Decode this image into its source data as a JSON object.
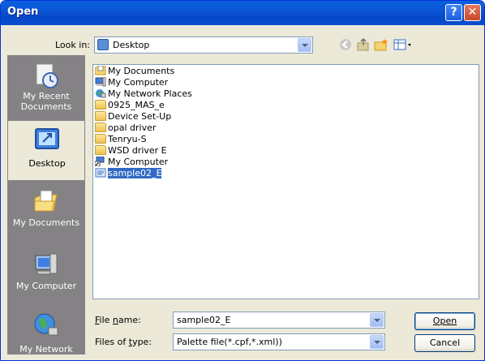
{
  "window": {
    "title": "Open",
    "help_label": "?",
    "close_label": "✕"
  },
  "lookin": {
    "label": "Look in:",
    "value": "Desktop"
  },
  "places": [
    {
      "label": "My Recent\nDocuments",
      "icon": "recent-documents-icon"
    },
    {
      "label": "Desktop",
      "icon": "desktop-icon"
    },
    {
      "label": "My Documents",
      "icon": "my-documents-icon"
    },
    {
      "label": "My Computer",
      "icon": "my-computer-icon"
    },
    {
      "label": "My Network",
      "icon": "my-network-icon"
    }
  ],
  "files": [
    {
      "name": "My Documents",
      "icon": "my-documents-icon"
    },
    {
      "name": "My Computer",
      "icon": "my-computer-icon"
    },
    {
      "name": "My Network Places",
      "icon": "network-places-icon"
    },
    {
      "name": "0925_MAS_e",
      "icon": "folder-icon"
    },
    {
      "name": "Device Set-Up",
      "icon": "folder-icon"
    },
    {
      "name": "opal driver",
      "icon": "folder-icon"
    },
    {
      "name": "Tenryu-S",
      "icon": "folder-icon"
    },
    {
      "name": "WSD driver E",
      "icon": "folder-icon"
    },
    {
      "name": "My Computer",
      "icon": "shortcut-icon"
    },
    {
      "name": "sample02_E",
      "icon": "file-icon",
      "selected": true
    }
  ],
  "filename": {
    "label": "File name:",
    "value": "sample02_E"
  },
  "filetype": {
    "label": "Files of type:",
    "value": "Palette file(*.cpf,*.xml))"
  },
  "buttons": {
    "open": "Open",
    "cancel": "Cancel"
  }
}
